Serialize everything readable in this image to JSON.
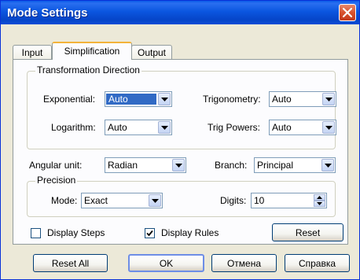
{
  "window": {
    "title": "Mode Settings"
  },
  "tabs": [
    {
      "label": "Input"
    },
    {
      "label": "Simplification"
    },
    {
      "label": "Output"
    }
  ],
  "transformation": {
    "group_label": "Transformation Direction",
    "exponential": {
      "label": "Exponential:",
      "value": "Auto"
    },
    "trigonometry": {
      "label": "Trigonometry:",
      "value": "Auto"
    },
    "logarithm": {
      "label": "Logarithm:",
      "value": "Auto"
    },
    "trig_powers": {
      "label": "Trig Powers:",
      "value": "Auto"
    }
  },
  "angular_unit": {
    "label": "Angular unit:",
    "value": "Radian"
  },
  "branch": {
    "label": "Branch:",
    "value": "Principal"
  },
  "precision": {
    "group_label": "Precision",
    "mode": {
      "label": "Mode:",
      "value": "Exact"
    },
    "digits": {
      "label": "Digits:",
      "value": "10"
    }
  },
  "options": {
    "display_steps": {
      "label": "Display Steps",
      "checked": false
    },
    "display_rules": {
      "label": "Display Rules",
      "checked": true
    },
    "reset_label": "Reset"
  },
  "footer": {
    "reset_all": "Reset All",
    "ok": "OK",
    "cancel": "Отмена",
    "help": "Справка"
  },
  "colors": {
    "titlebar": "#0a4cd6",
    "selection": "#316ac5",
    "dialog_bg": "#ece9d8",
    "tab_accent": "#f3b33a"
  }
}
